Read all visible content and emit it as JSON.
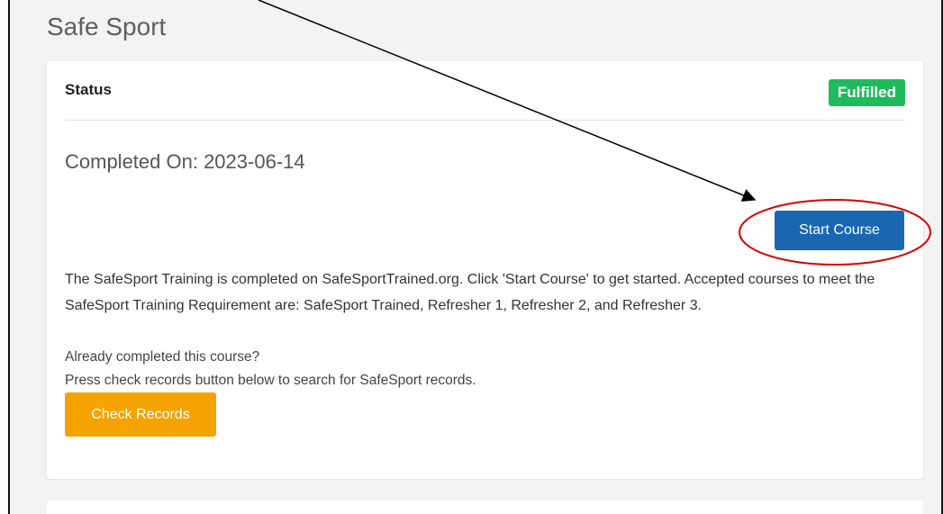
{
  "page": {
    "title": "Safe Sport"
  },
  "status_card": {
    "status_label": "Status",
    "badge": "Fulfilled",
    "completed_on": "Completed On: 2023-06-14",
    "start_button": "Start Course",
    "description": "The SafeSport Training is completed on SafeSportTrained.org. Click 'Start Course' to get started. Accepted courses to meet the SafeSport Training Requirement are: SafeSport Trained, Refresher 1, Refresher 2, and Refresher 3.",
    "already_completed": "Already completed this course?",
    "press_check": "Press check records button below to search for SafeSport records.",
    "check_button": "Check Records"
  },
  "colors": {
    "badge": "#1fba5c",
    "start_button": "#1a66b1",
    "check_button": "#f4a300",
    "annotation_circle": "#d80000",
    "annotation_arrow": "#000000"
  }
}
